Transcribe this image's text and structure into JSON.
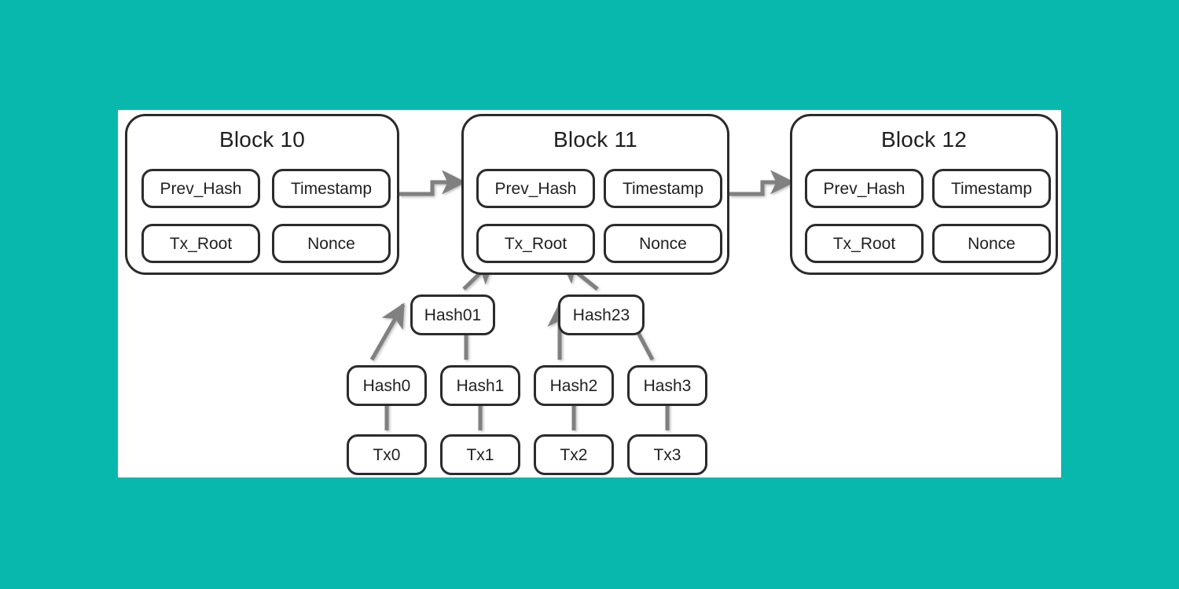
{
  "theme": {
    "background_color": "#08b8ad",
    "panel_color": "#ffffff",
    "outline_color": "#2b2b2b",
    "arrow_color": "#808080",
    "text_color": "#1f1f1f"
  },
  "diagram": {
    "type": "blockchain-merkle-tree",
    "blocks": [
      {
        "title": "Block 10",
        "fields": [
          {
            "label": "Prev_Hash"
          },
          {
            "label": "Timestamp"
          },
          {
            "label": "Tx_Root"
          },
          {
            "label": "Nonce"
          }
        ]
      },
      {
        "title": "Block 11",
        "fields": [
          {
            "label": "Prev_Hash"
          },
          {
            "label": "Timestamp"
          },
          {
            "label": "Tx_Root"
          },
          {
            "label": "Nonce"
          }
        ]
      },
      {
        "title": "Block 12",
        "fields": [
          {
            "label": "Prev_Hash"
          },
          {
            "label": "Timestamp"
          },
          {
            "label": "Tx_Root"
          },
          {
            "label": "Nonce"
          }
        ]
      }
    ],
    "merkle": {
      "intermediate": [
        {
          "label": "Hash01"
        },
        {
          "label": "Hash23"
        }
      ],
      "leaf_hashes": [
        {
          "label": "Hash0"
        },
        {
          "label": "Hash1"
        },
        {
          "label": "Hash2"
        },
        {
          "label": "Hash3"
        }
      ],
      "transactions": [
        {
          "label": "Tx0"
        },
        {
          "label": "Tx1"
        },
        {
          "label": "Tx2"
        },
        {
          "label": "Tx3"
        }
      ]
    }
  }
}
